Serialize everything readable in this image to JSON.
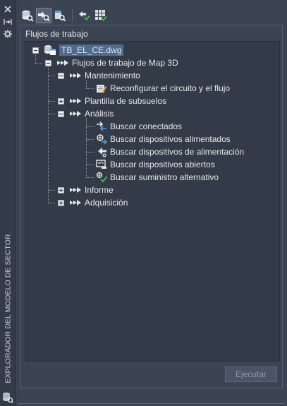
{
  "palette": {
    "title": "EXPLORADOR DEL MODELO DE SECTOR",
    "buttons": [
      "close-icon",
      "auto-hide-icon",
      "properties-icon"
    ]
  },
  "toolbar": {
    "buttons": [
      {
        "icon": "database-search-icon",
        "active": false
      },
      {
        "icon": "workflow-run-icon",
        "active": true
      },
      {
        "icon": "model-search-icon",
        "active": false
      },
      {
        "icon": "arrow-check-icon",
        "active": false
      },
      {
        "icon": "grid-check-icon",
        "active": false
      }
    ]
  },
  "workflow": {
    "section_title": "Flujos de trabajo",
    "run_label": "Ejecutar"
  },
  "tree": {
    "file": "TB_EL_CE.dwg",
    "root": "Flujos de trabajo de Map 3D",
    "groups": [
      {
        "label": "Mantenimiento",
        "expanded": true,
        "items": [
          "Reconfigurar el circuito y el flujo"
        ]
      },
      {
        "label": "Plantilla de subsuelos",
        "expanded": false,
        "items": []
      },
      {
        "label": "Análisis",
        "expanded": true,
        "items": [
          "Buscar conectados",
          "Buscar dispositivos alimentados",
          "Buscar dispositivos de alimentación",
          "Buscar dispositivos abiertos",
          "Buscar suministro alternativo"
        ]
      },
      {
        "label": "Informe",
        "expanded": false,
        "items": []
      },
      {
        "label": "Adquisición",
        "expanded": false,
        "items": []
      }
    ]
  },
  "colors": {
    "panel_bg": "#3b4453",
    "tree_bg": "#333b48",
    "selection": "#4f6b8f",
    "check_green": "#4caf50"
  }
}
